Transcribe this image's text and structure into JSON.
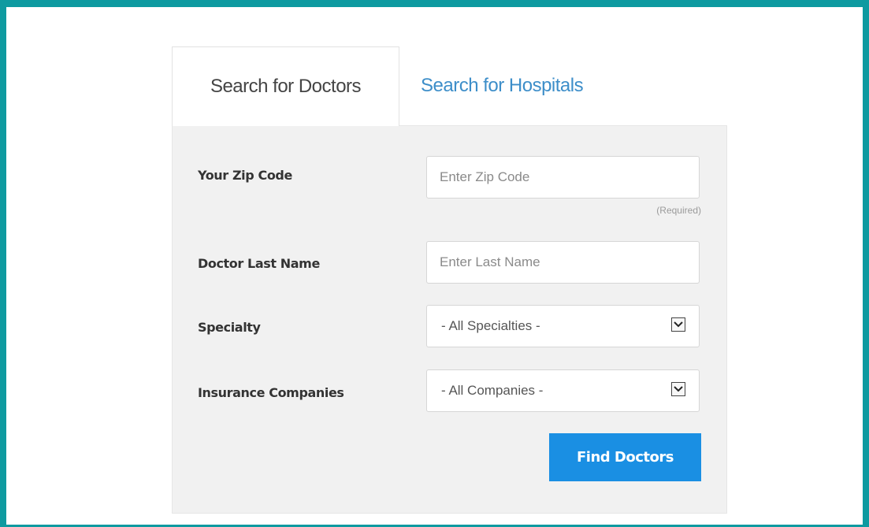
{
  "tabs": {
    "doctors": "Search for Doctors",
    "hospitals": "Search for Hospitals"
  },
  "form": {
    "zip": {
      "label": "Your Zip Code",
      "placeholder": "Enter Zip Code",
      "value": "",
      "note": "(Required)"
    },
    "last_name": {
      "label": "Doctor Last Name",
      "placeholder": "Enter Last Name",
      "value": ""
    },
    "specialty": {
      "label": "Specialty",
      "selected": "- All Specialties -"
    },
    "insurance": {
      "label": "Insurance Companies",
      "selected": "- All Companies -"
    },
    "submit_label": "Find Doctors"
  },
  "colors": {
    "frame_border": "#0e9aa0",
    "tab_link": "#3d8ec9",
    "primary_button": "#1a8fe3",
    "panel_background": "#f1f1f1"
  },
  "icons": {
    "select_arrow": "chevron-down-icon"
  }
}
